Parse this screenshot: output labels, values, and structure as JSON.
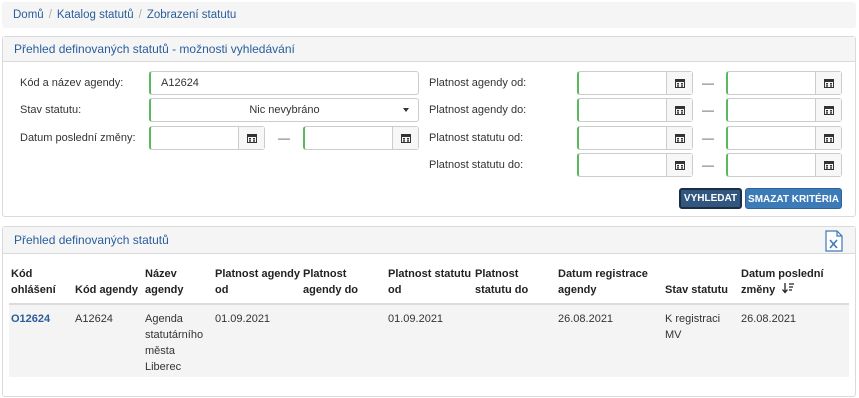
{
  "breadcrumb": [
    "Domů",
    "Katalog statutů",
    "Zobrazení statutu"
  ],
  "search_panel": {
    "title": "Přehled definovaných statutů - možnosti vyhledávání",
    "fields": {
      "agenda_code_label": "Kód a název agendy:",
      "agenda_code_value": "A12624",
      "status_label": "Stav statutu:",
      "status_value": "Nic nevybráno",
      "last_change_label": "Datum poslední změny:",
      "agenda_valid_from_label": "Platnost agendy od:",
      "agenda_valid_to_label": "Platnost agendy do:",
      "status_valid_from_label": "Platnost statutu od:",
      "status_valid_to_label": "Platnost statutu do:",
      "range_separator": "—"
    },
    "buttons": {
      "search": "VYHLEDAT",
      "clear": "SMAZAT KRITÉRIA"
    }
  },
  "results_panel": {
    "title": "Přehled definovaných statutů",
    "export_icon": "excel-export-icon",
    "columns": [
      "Kód ohlášení",
      "Kód agendy",
      "Název agendy",
      "Platnost agendy od",
      "Platnost agendy do",
      "Platnost statutu od",
      "Platnost statutu do",
      "Datum registrace agendy",
      "Stav statutu",
      "Datum poslední změny"
    ],
    "rows": [
      {
        "code": "O12624",
        "agenda_code": "A12624",
        "agenda_name": "Agenda statutárního města Liberec",
        "agenda_valid_from": "01.09.2021",
        "agenda_valid_to": "",
        "status_valid_from": "01.09.2021",
        "status_valid_to": "",
        "registration_date": "26.08.2021",
        "status": "K registraci MV",
        "last_change": "26.08.2021"
      }
    ]
  }
}
